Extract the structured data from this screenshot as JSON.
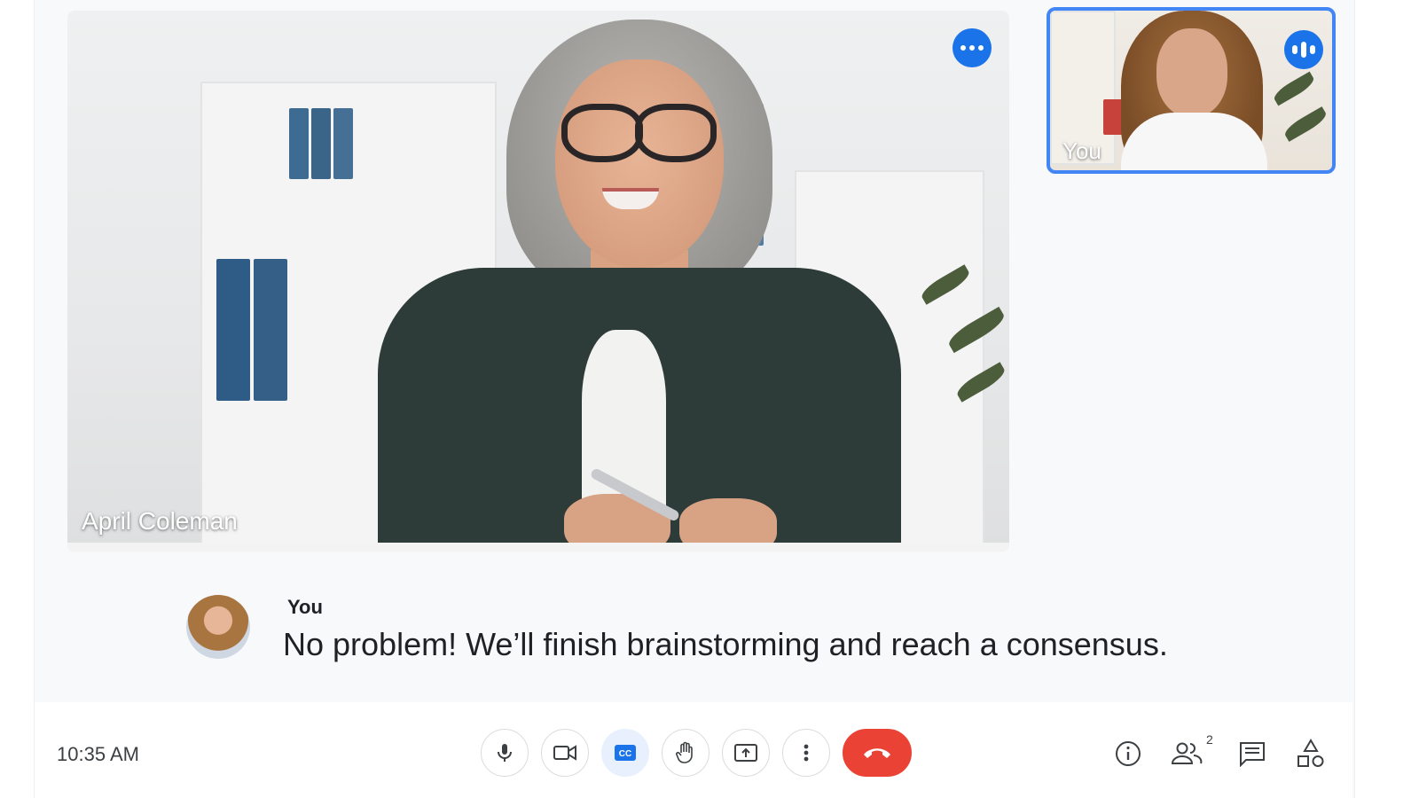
{
  "main_video": {
    "participant_name": "April Coleman",
    "options_icon": "more-horiz-icon"
  },
  "self_view": {
    "label": "You",
    "speaking_icon": "audio-level-icon"
  },
  "caption": {
    "speaker": "You",
    "text": "No problem! We’ll finish brainstorming and reach a consensus."
  },
  "bottom_bar": {
    "time": "10:35 AM",
    "controls": [
      {
        "name": "microphone",
        "icon": "mic-icon"
      },
      {
        "name": "camera",
        "icon": "videocam-icon"
      },
      {
        "name": "captions",
        "icon": "cc-icon",
        "active": true
      },
      {
        "name": "raise-hand",
        "icon": "hand-icon"
      },
      {
        "name": "present",
        "icon": "present-screen-icon"
      },
      {
        "name": "more-options",
        "icon": "more-vert-icon"
      },
      {
        "name": "leave-call",
        "icon": "call-end-icon"
      }
    ],
    "right_icons": [
      {
        "name": "meeting-details",
        "icon": "info-icon"
      },
      {
        "name": "people",
        "icon": "people-icon",
        "count": "2"
      },
      {
        "name": "chat",
        "icon": "chat-icon"
      },
      {
        "name": "activities",
        "icon": "shapes-icon"
      }
    ]
  },
  "colors": {
    "accent": "#1a73e8",
    "self_border": "#4285f4",
    "end_call": "#ea4335",
    "active_control_bg": "#e8f0fe"
  }
}
